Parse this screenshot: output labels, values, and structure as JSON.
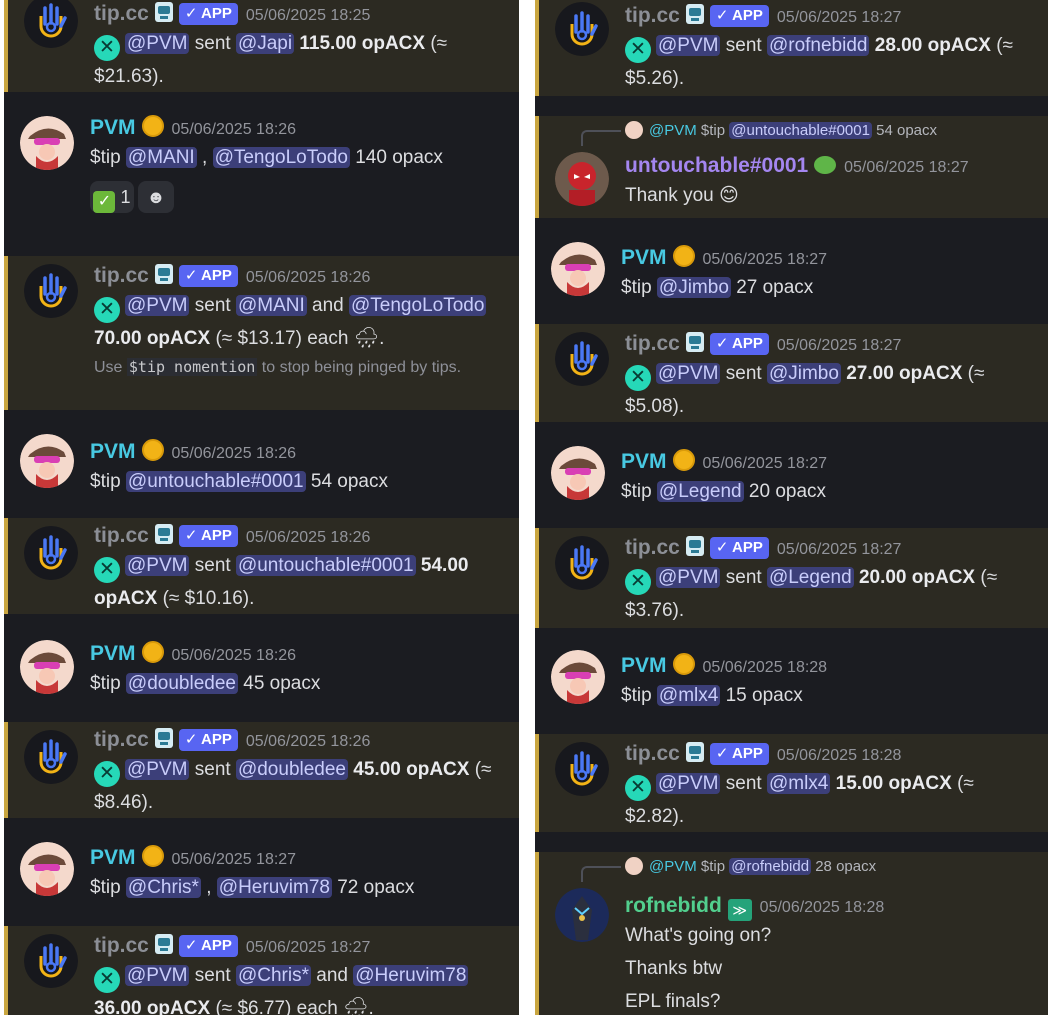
{
  "app": {
    "badge": "✓ APP",
    "tip_command": "$tip"
  },
  "colors": {
    "accent_gold": "#c9a640",
    "mention_bg": "#3c3f79",
    "app_badge": "#5865f2",
    "pvm_name": "#48c9e2",
    "bot_name": "#8c8f96"
  },
  "icons": {
    "bot_avatar": "tipcc-hand-icon",
    "opacx": "opacx-token-icon",
    "verified": "verified-bot-icon",
    "rain": "cloud-rain-icon",
    "coin": "gold-coin-icon"
  },
  "left": {
    "m1": {
      "author": "tip.cc",
      "timestamp": "05/06/2025 18:25",
      "sender": "@PVM",
      "verb": "sent",
      "to": "@Japi",
      "amount": "115.00 opACX",
      "tail": "(≈",
      "usd": "$21.63)."
    },
    "m2": {
      "author": "PVM",
      "timestamp": "05/06/2025 18:26",
      "mention1": "@MANI",
      "sep": " , ",
      "mention2": "@TengoLoTodo",
      "rest": "140 opacx",
      "reaction_count": "1",
      "reaction_emoji": "✅"
    },
    "m3": {
      "author": "tip.cc",
      "timestamp": "05/06/2025 18:26",
      "sender": "@PVM",
      "verb": "sent",
      "to1": "@MANI",
      "and": "and",
      "to2": "@TengoLoTodo",
      "amount": "70.00 opACX",
      "usd": "(≈ $13.17) each",
      "hint_pre": "Use",
      "hint_code": "$tip nomention",
      "hint_post": "to stop being pinged by tips."
    },
    "m4": {
      "author": "PVM",
      "timestamp": "05/06/2025 18:26",
      "mention": "@untouchable#0001",
      "rest": "54 opacx"
    },
    "m5": {
      "author": "tip.cc",
      "timestamp": "05/06/2025 18:26",
      "sender": "@PVM",
      "verb": "sent",
      "to": "@untouchable#0001",
      "amount1": "54.00",
      "amount2": "opACX",
      "usd": "(≈ $10.16)."
    },
    "m6": {
      "author": "PVM",
      "timestamp": "05/06/2025 18:26",
      "mention": "@doubledee",
      "rest": "45 opacx"
    },
    "m7": {
      "author": "tip.cc",
      "timestamp": "05/06/2025 18:26",
      "sender": "@PVM",
      "verb": "sent",
      "to": "@doubledee",
      "amount": "45.00 opACX",
      "tail": "(≈",
      "usd": "$8.46)."
    },
    "m8": {
      "author": "PVM",
      "timestamp": "05/06/2025 18:27",
      "mention1": "@Chris*",
      "sep": " , ",
      "mention2": "@Heruvim78",
      "rest": "72 opacx"
    },
    "m9": {
      "author": "tip.cc",
      "timestamp": "05/06/2025 18:27",
      "sender": "@PVM",
      "verb": "sent",
      "to1": "@Chris*",
      "and": "and",
      "to2": "@Heruvim78",
      "amount": "36.00 opACX",
      "usd": "(≈ $6.77) each"
    }
  },
  "right": {
    "m1": {
      "author": "tip.cc",
      "timestamp": "05/06/2025 18:27",
      "sender": "@PVM",
      "verb": "sent",
      "to": "@rofnebidd",
      "amount": "28.00 opACX",
      "tail": "(≈",
      "usd": "$5.26)."
    },
    "m2": {
      "reply_author": "@PVM",
      "reply_text": "$tip",
      "reply_mention": "@untouchable#0001",
      "reply_rest": "54 opacx",
      "author": "untouchable#0001",
      "timestamp": "05/06/2025 18:27",
      "text": "Thank you",
      "emoji": "😊"
    },
    "m3": {
      "author": "PVM",
      "timestamp": "05/06/2025 18:27",
      "mention": "@Jimbo",
      "rest": "27 opacx"
    },
    "m4": {
      "author": "tip.cc",
      "timestamp": "05/06/2025 18:27",
      "sender": "@PVM",
      "verb": "sent",
      "to": "@Jimbo",
      "amount": "27.00 opACX",
      "tail": "(≈",
      "usd": "$5.08)."
    },
    "m5": {
      "author": "PVM",
      "timestamp": "05/06/2025 18:27",
      "mention": "@Legend",
      "rest": "20 opacx"
    },
    "m6": {
      "author": "tip.cc",
      "timestamp": "05/06/2025 18:27",
      "sender": "@PVM",
      "verb": "sent",
      "to": "@Legend",
      "amount": "20.00 opACX",
      "tail": "(≈",
      "usd": "$3.76)."
    },
    "m7": {
      "author": "PVM",
      "timestamp": "05/06/2025 18:28",
      "mention": "@mlx4",
      "rest": "15 opacx"
    },
    "m8": {
      "author": "tip.cc",
      "timestamp": "05/06/2025 18:28",
      "sender": "@PVM",
      "verb": "sent",
      "to": "@mlx4",
      "amount": "15.00 opACX",
      "tail": "(≈",
      "usd": "$2.82)."
    },
    "m9": {
      "reply_author": "@PVM",
      "reply_text": "$tip",
      "reply_mention": "@rofnebidd",
      "reply_rest": "28 opacx",
      "author": "rofnebidd",
      "timestamp": "05/06/2025 18:28",
      "line1": "What's going on?",
      "line2": "Thanks btw",
      "line3": "EPL finals?"
    }
  }
}
